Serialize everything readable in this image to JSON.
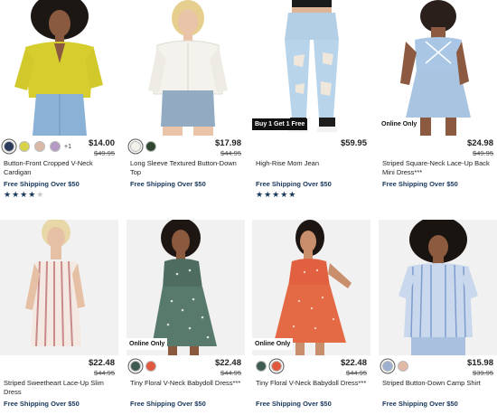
{
  "products": [
    {
      "name": "Button-Front Cropped V-Neck Cardigan",
      "price": "$14.00",
      "was_price": "$49.95",
      "shipping": "Free Shipping Over $50",
      "badge": "",
      "swatches": [
        "#2c3a5a",
        "#d8d24a",
        "#d9b9a6",
        "#b49ac3"
      ],
      "more_swatches": "+1",
      "rating_text": "★★★★☆",
      "rating": 4,
      "image": "model in yellow cardigan"
    },
    {
      "name": "Long Sleeve Textured Button-Down Top",
      "price": "$17.98",
      "was_price": "$44.95",
      "shipping": "Free Shipping Over $50",
      "badge": "",
      "swatches": [
        "#f4f1ea",
        "#2f4630"
      ],
      "more_swatches": "",
      "rating_text": "",
      "rating": 0,
      "image": "model in white button-down"
    },
    {
      "name": "High-Rise Mom Jean",
      "price": "$59.95",
      "was_price": "",
      "shipping": "Free Shipping Over $50",
      "badge": "Buy 1 Get 1 Free",
      "swatches": [],
      "more_swatches": "",
      "rating_text": "★★★★★",
      "rating": 5,
      "image": "ripped light wash jeans"
    },
    {
      "name": "Striped Square-Neck Lace-Up Back Mini Dress***",
      "price": "$24.98",
      "was_price": "$49.95",
      "shipping": "Free Shipping Over $50",
      "badge": "Online Only",
      "swatches": [],
      "more_swatches": "",
      "rating_text": "",
      "rating": 0,
      "image": "back of blue striped mini dress"
    },
    {
      "name": "Striped Sweetheart Lace-Up Slim Dress",
      "price": "$22.48",
      "was_price": "$44.95",
      "shipping": "Free Shipping Over $50",
      "badge": "",
      "swatches": [],
      "more_swatches": "",
      "rating_text": "",
      "rating": 0,
      "image": "model in striped slim dress"
    },
    {
      "name": "Tiny Floral V-Neck Babydoll Dress***",
      "price": "$22.48",
      "was_price": "$44.95",
      "shipping": "Free Shipping Over $50",
      "badge": "Online Only",
      "swatches": [
        "#3f5b52",
        "#e0583e"
      ],
      "more_swatches": "",
      "rating_text": "",
      "rating": 0,
      "image": "model in green floral babydoll dress"
    },
    {
      "name": "Tiny Floral V-Neck Babydoll Dress***",
      "price": "$22.48",
      "was_price": "$44.95",
      "shipping": "Free Shipping Over $50",
      "badge": "Online Only",
      "swatches": [
        "#3f5b52",
        "#e0583e"
      ],
      "more_swatches": "",
      "rating_text": "",
      "rating": 0,
      "image": "model in orange floral babydoll dress"
    },
    {
      "name": "Striped Button-Down Camp Shirt",
      "price": "$15.98",
      "was_price": "$39.95",
      "shipping": "Free Shipping Over $50",
      "badge": "",
      "swatches": [
        "#9db0cf",
        "#e2b9a6"
      ],
      "more_swatches": "",
      "rating_text": "",
      "rating": 0,
      "image": "model in blue striped camp shirt"
    }
  ],
  "colors": {
    "shipping_text": "#17365d",
    "star_filled": "#17365d",
    "star_empty": "#c9c9c9"
  }
}
